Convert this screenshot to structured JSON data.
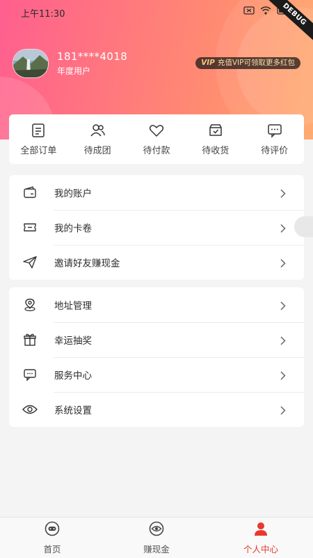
{
  "status_bar": {
    "time": "上午11:30",
    "debug_label": "DEBUG"
  },
  "profile": {
    "phone": "181****4018",
    "user_type": "年度用户",
    "vip_tag": "VIP",
    "vip_text": "充值VIP可领取更多红包"
  },
  "orders": {
    "items": [
      {
        "label": "全部订单",
        "icon": "order-list-icon"
      },
      {
        "label": "待成团",
        "icon": "group-icon"
      },
      {
        "label": "待付款",
        "icon": "heart-icon"
      },
      {
        "label": "待收货",
        "icon": "package-icon"
      },
      {
        "label": "待评价",
        "icon": "comment-icon"
      }
    ]
  },
  "menu_group_1": {
    "items": [
      {
        "label": "我的账户",
        "icon": "wallet-icon"
      },
      {
        "label": "我的卡卷",
        "icon": "ticket-icon"
      },
      {
        "label": "邀请好友赚现金",
        "icon": "paper-plane-icon"
      }
    ]
  },
  "menu_group_2": {
    "items": [
      {
        "label": "地址管理",
        "icon": "location-icon"
      },
      {
        "label": "幸运抽奖",
        "icon": "gift-icon"
      },
      {
        "label": "服务中心",
        "icon": "chat-icon"
      },
      {
        "label": "系统设置",
        "icon": "eye-icon"
      }
    ]
  },
  "bottom_nav": {
    "items": [
      {
        "label": "首页",
        "icon": "home-icon",
        "active": false
      },
      {
        "label": "赚现金",
        "icon": "eye-icon",
        "active": false
      },
      {
        "label": "个人中心",
        "icon": "person-icon",
        "active": true
      }
    ]
  },
  "colors": {
    "accent": "#e8382f",
    "header_gradient_start": "#ff5f8f",
    "header_gradient_end": "#ffa364",
    "vip_gold": "#f5dfa6"
  }
}
